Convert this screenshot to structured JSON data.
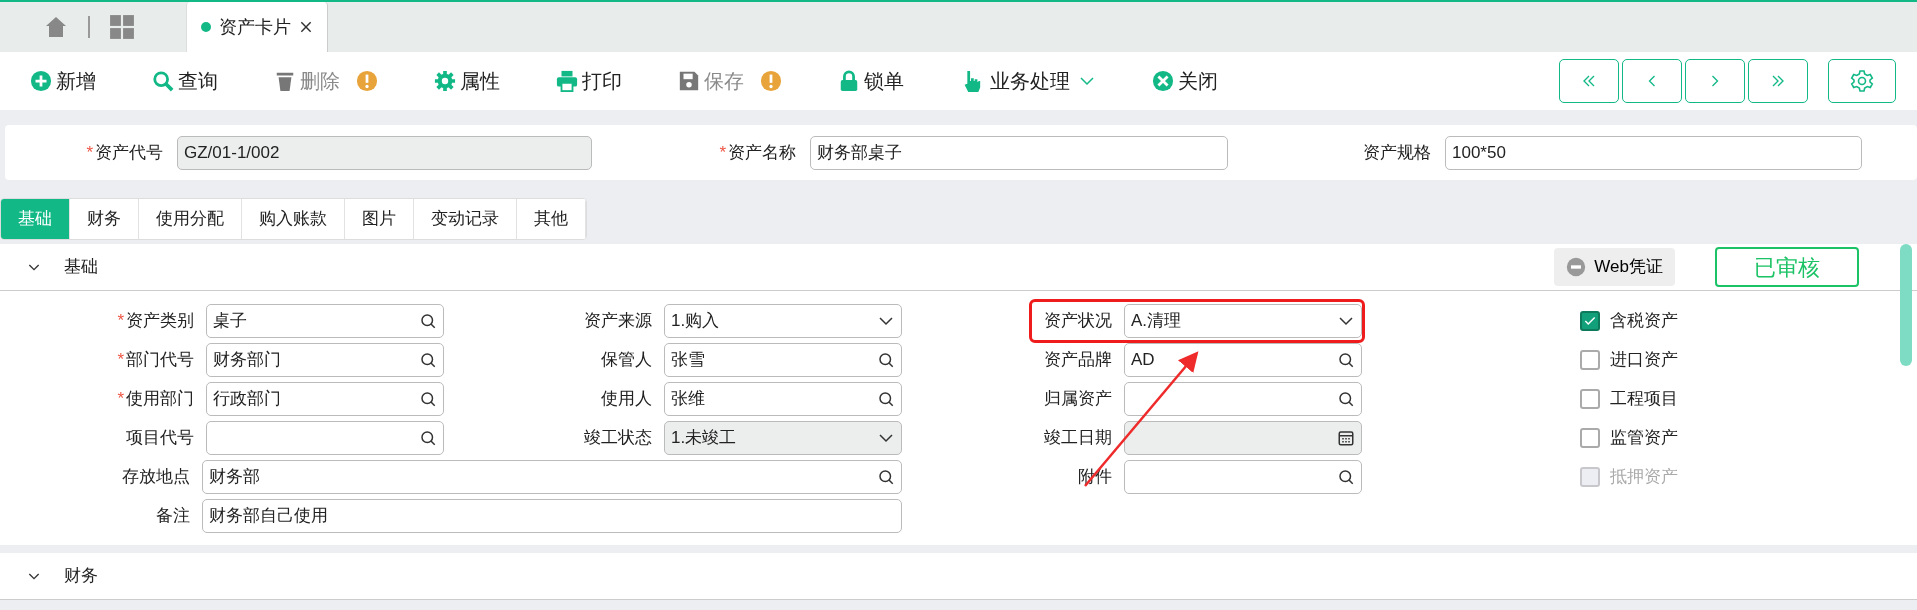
{
  "top_tabs": [
    {
      "label": "资产卡片",
      "selected": true
    }
  ],
  "toolbar": [
    {
      "label": "新增",
      "kind": "add",
      "disabled": false,
      "warning": false,
      "dropdown": false
    },
    {
      "label": "查询",
      "kind": "search",
      "disabled": false,
      "warning": false,
      "dropdown": false
    },
    {
      "label": "删除",
      "kind": "delete",
      "disabled": true,
      "warning": true,
      "dropdown": false
    },
    {
      "label": "属性",
      "kind": "settings",
      "disabled": false,
      "warning": false,
      "dropdown": false
    },
    {
      "label": "打印",
      "kind": "print",
      "disabled": false,
      "warning": false,
      "dropdown": false
    },
    {
      "label": "保存",
      "kind": "save",
      "disabled": true,
      "warning": true,
      "dropdown": false
    },
    {
      "label": "锁单",
      "kind": "lock",
      "disabled": false,
      "warning": false,
      "dropdown": false
    },
    {
      "label": "业务处理",
      "kind": "process",
      "disabled": false,
      "warning": false,
      "dropdown": true
    },
    {
      "label": "关闭",
      "kind": "close",
      "disabled": false,
      "warning": false,
      "dropdown": false
    }
  ],
  "header_fields": [
    {
      "required_mark": "*",
      "label": "资产代号",
      "value": "GZ/01-1/002",
      "disabled": true
    },
    {
      "required_mark": "*",
      "label": "资产名称",
      "value": "财务部桌子",
      "disabled": false
    },
    {
      "label": "资产规格",
      "value": "100*50",
      "disabled": false
    }
  ],
  "form_tabs": [
    {
      "label": "基础",
      "selected": true
    },
    {
      "label": "财务",
      "selected": false
    },
    {
      "label": "使用分配",
      "selected": false
    },
    {
      "label": "购入账款",
      "selected": false
    },
    {
      "label": "图片",
      "selected": false
    },
    {
      "label": "变动记录",
      "selected": false
    },
    {
      "label": "其他",
      "selected": false
    }
  ],
  "sections": [
    {
      "title": "基础",
      "expanded": true
    },
    {
      "title": "财务",
      "expanded": true
    }
  ],
  "voucher_button": "Web凭证",
  "status_stamp": "已审核",
  "fields": [
    [
      {
        "required_mark": "*",
        "label": "资产类别",
        "kind": "lookup",
        "value": "桌子",
        "disabled": false,
        "wide": false,
        "highlighted": false
      },
      {
        "label": "资产来源",
        "kind": "select",
        "value": "1.购入",
        "disabled": false,
        "wide": false,
        "highlighted": false
      },
      {
        "label": "资产状况",
        "kind": "select",
        "value": "A.清理",
        "disabled": false,
        "wide": false,
        "highlighted": true
      }
    ],
    [
      {
        "required_mark": "*",
        "label": "部门代号",
        "kind": "lookup",
        "value": "财务部门",
        "disabled": false,
        "wide": false,
        "highlighted": false
      },
      {
        "label": "保管人",
        "kind": "lookup",
        "value": "张雪",
        "disabled": false,
        "wide": false,
        "highlighted": false
      },
      {
        "label": "资产品牌",
        "kind": "lookup",
        "value": "AD",
        "disabled": false,
        "wide": false,
        "highlighted": false
      }
    ],
    [
      {
        "required_mark": "*",
        "label": "使用部门",
        "kind": "lookup",
        "value": "行政部门",
        "disabled": false,
        "wide": false,
        "highlighted": false
      },
      {
        "label": "使用人",
        "kind": "lookup",
        "value": "张维",
        "disabled": false,
        "wide": false,
        "highlighted": false
      },
      {
        "label": "归属资产",
        "kind": "lookup",
        "disabled": false,
        "wide": false,
        "highlighted": false
      }
    ],
    [
      {
        "label": "项目代号",
        "kind": "lookup",
        "disabled": false,
        "wide": false,
        "highlighted": false
      },
      {
        "label": "竣工状态",
        "kind": "select",
        "value": "1.未竣工",
        "disabled": true,
        "wide": false,
        "highlighted": false
      },
      {
        "label": "竣工日期",
        "kind": "date",
        "disabled": true,
        "wide": false,
        "highlighted": false
      }
    ],
    [
      {
        "label": "存放地点",
        "kind": "lookup",
        "value": "财务部",
        "disabled": false,
        "wide": true,
        "highlighted": false
      },
      {
        "label": "附件",
        "kind": "lookup",
        "disabled": false,
        "wide": false,
        "highlighted": false
      }
    ],
    [
      {
        "label": "备注",
        "kind": "text",
        "value": "财务部自己使用",
        "disabled": false,
        "wide": true,
        "highlighted": false
      }
    ]
  ],
  "checkboxes": [
    {
      "label": "含税资产",
      "checked": true,
      "disabled": false
    },
    {
      "label": "进口资产",
      "checked": false,
      "disabled": false
    },
    {
      "label": "工程项目",
      "checked": false,
      "disabled": false
    },
    {
      "label": "监管资产",
      "checked": false,
      "disabled": false
    },
    {
      "label": "抵押资产",
      "checked": false,
      "disabled": true
    }
  ]
}
